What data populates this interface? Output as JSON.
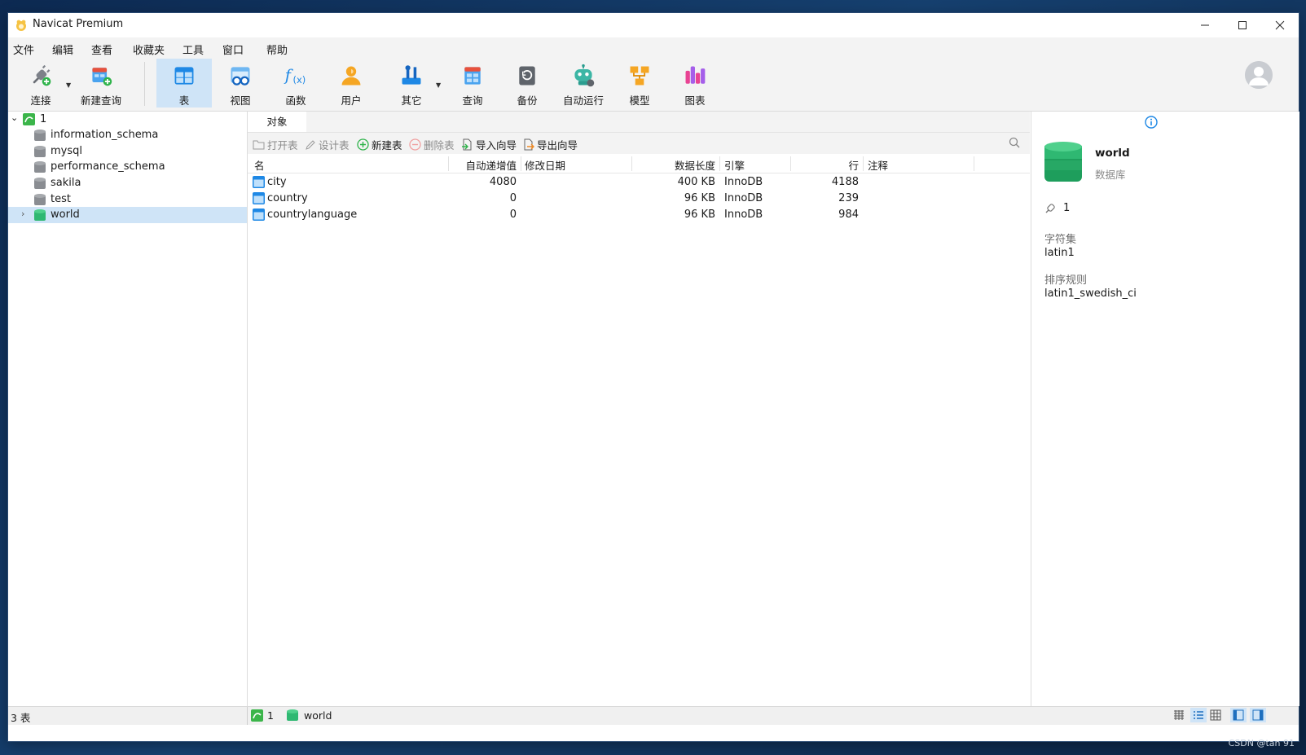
{
  "window": {
    "title": "Navicat Premium"
  },
  "menu": [
    "文件",
    "编辑",
    "查看",
    "收藏夹",
    "工具",
    "窗口",
    "帮助"
  ],
  "toolbar": {
    "connect": "连接",
    "new_query": "新建查询",
    "table": "表",
    "view": "视图",
    "function": "函数",
    "user": "用户",
    "others": "其它",
    "query": "查询",
    "backup": "备份",
    "automation": "自动运行",
    "model": "模型",
    "chart": "图表"
  },
  "navigator": {
    "connection": "1",
    "databases": [
      "information_schema",
      "mysql",
      "performance_schema",
      "sakila",
      "test",
      "world"
    ],
    "selected": "world"
  },
  "tabs": {
    "objects": "对象"
  },
  "object_toolbar": {
    "open": "打开表",
    "design": "设计表",
    "new": "新建表",
    "delete": "删除表",
    "import": "导入向导",
    "export": "导出向导"
  },
  "table": {
    "columns": {
      "name": "名",
      "auto_increment": "自动递增值",
      "modified": "修改日期",
      "data_length": "数据长度",
      "engine": "引擎",
      "rows": "行",
      "comment": "注释"
    },
    "rows": [
      {
        "name": "city",
        "auto_increment": "4080",
        "modified": "",
        "data_length": "400 KB",
        "engine": "InnoDB",
        "rows": "4188",
        "comment": ""
      },
      {
        "name": "country",
        "auto_increment": "0",
        "modified": "",
        "data_length": "96 KB",
        "engine": "InnoDB",
        "rows": "239",
        "comment": ""
      },
      {
        "name": "countrylanguage",
        "auto_increment": "0",
        "modified": "",
        "data_length": "96 KB",
        "engine": "InnoDB",
        "rows": "984",
        "comment": ""
      }
    ]
  },
  "info_panel": {
    "name": "world",
    "type": "数据库",
    "connection": "1",
    "charset_label": "字符集",
    "charset": "latin1",
    "collation_label": "排序规则",
    "collation": "latin1_swedish_ci"
  },
  "status": {
    "count": "3 表",
    "connection": "1",
    "database": "world"
  },
  "watermark": "CSDN @tan 91",
  "colors": {
    "selection": "#cfe4f7",
    "accent": "#1e88e5",
    "db_green": "#2fb872"
  }
}
